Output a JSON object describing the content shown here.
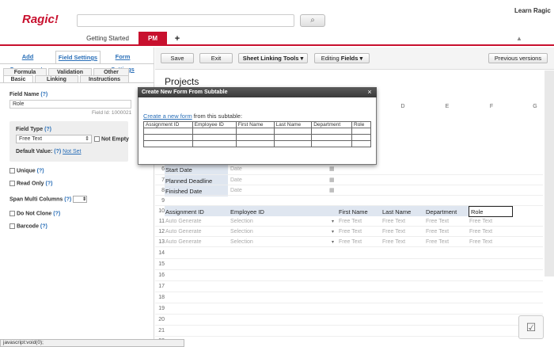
{
  "app": {
    "logo": "Ragic!",
    "learn": "Learn Ragic",
    "search_btn": "⌕"
  },
  "tabs": [
    "Getting Started",
    "PM",
    "+"
  ],
  "left": {
    "tabs": [
      "Add Components",
      "Field Settings",
      "Form Settings"
    ],
    "subtabs_row1": [
      "Formula",
      "Validation",
      "Other"
    ],
    "subtabs_row2": [
      "Basic",
      "Linking",
      "Instructions"
    ],
    "field_name_label": "Field Name",
    "help": "(?)",
    "field_name_value": "Role",
    "field_id": "Field Id: 1000021",
    "field_type_label": "Field Type",
    "field_type_value": "Free Text",
    "not_empty": "Not Empty",
    "default_label": "Default Value:",
    "not_set": "Not Set",
    "unique": "Unique",
    "read_only": "Read Only",
    "span": "Span Multi Columns",
    "do_not_clone": "Do Not Clone",
    "barcode": "Barcode"
  },
  "toolbar": {
    "save": "Save",
    "exit": "Exit",
    "sheet_linking": "Sheet Linking Tools ▾",
    "editing": "Editing",
    "fields": "Fields ▾",
    "prev": "Previous versions"
  },
  "sheet": {
    "title": "Projects",
    "col_heads": [
      "D",
      "E",
      "F",
      "G"
    ],
    "rows": {
      "r6": "Start Date",
      "r7": "Planned Deadline",
      "r8": "Finished Date"
    },
    "date_ph": "Date",
    "sub_headers": [
      "Assignment ID",
      "Employee ID",
      "First Name",
      "Last Name",
      "Department",
      "Role"
    ],
    "auto_gen": "Auto Generate",
    "selection": "Selection",
    "free_text": "Free Text"
  },
  "dialog": {
    "title": "Create New Form From Subtable",
    "link": "Create a new form",
    "suffix": " from this subtable:",
    "cols": [
      "Assignment ID",
      "Employee ID",
      "First Name",
      "Last Name",
      "Department",
      "Role"
    ]
  },
  "status": "javascript:void(0);"
}
